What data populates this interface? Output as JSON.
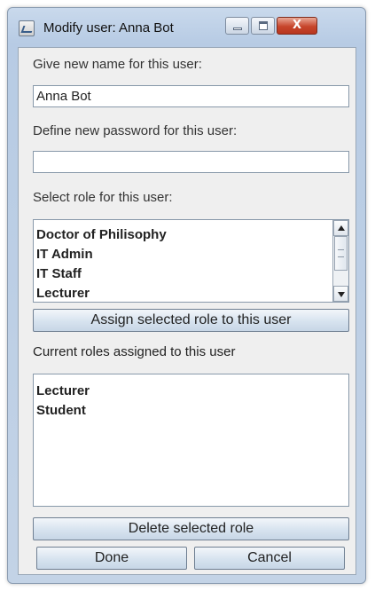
{
  "window": {
    "title": "Modify user: Anna Bot",
    "close_label": "X"
  },
  "name_section": {
    "label": "Give new name for this user:",
    "value": "Anna Bot"
  },
  "password_section": {
    "label": "Define new password for this user:",
    "value": ""
  },
  "role_select": {
    "label": "Select role for this user:",
    "options": [
      "Doctor of Philisophy",
      "IT Admin",
      "IT Staff",
      "Lecturer"
    ],
    "assign_button": "Assign selected role to this user"
  },
  "current_roles": {
    "label": "Current roles assigned to this user",
    "items": [
      "Lecturer",
      "Student"
    ],
    "delete_button": "Delete selected role"
  },
  "footer": {
    "done_button": "Done",
    "cancel_button": "Cancel"
  },
  "icons": {
    "app": "java-window-icon",
    "minimize": "minimize-icon",
    "maximize": "maximize-icon",
    "close": "close-icon",
    "scroll_up": "arrow-up-icon",
    "scroll_down": "arrow-down-icon"
  }
}
